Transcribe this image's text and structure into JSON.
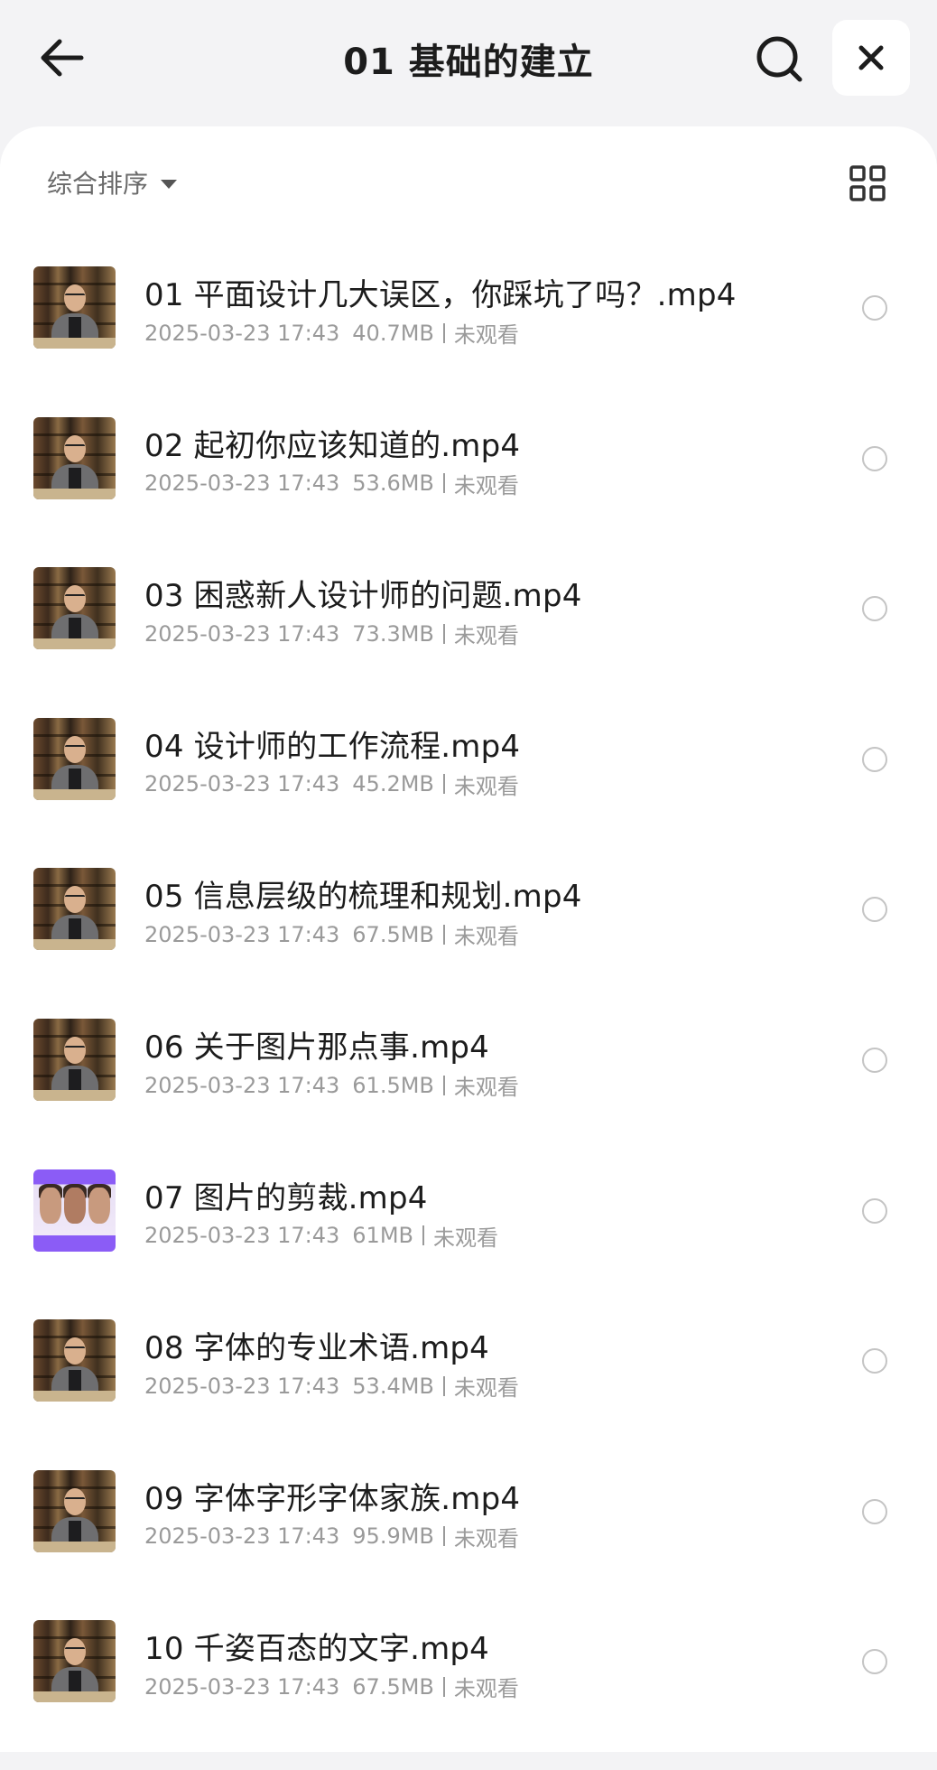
{
  "header": {
    "title": "01 基础的建立",
    "back_icon": "arrow-left-icon",
    "search_icon": "search-icon",
    "close_icon": "close-icon"
  },
  "toolbar": {
    "sort_label": "综合排序",
    "sort_icon": "caret-down-icon",
    "view_icon": "grid-view-icon"
  },
  "files": [
    {
      "name": "01 平面设计几大误区，你踩坑了吗？.mp4",
      "date": "2025-03-23 17:43",
      "size": "40.7MB",
      "status": "未观看",
      "thumb": "presenter"
    },
    {
      "name": "02 起初你应该知道的.mp4",
      "date": "2025-03-23 17:43",
      "size": "53.6MB",
      "status": "未观看",
      "thumb": "presenter"
    },
    {
      "name": "03 困惑新人设计师的问题.mp4",
      "date": "2025-03-23 17:43",
      "size": "73.3MB",
      "status": "未观看",
      "thumb": "presenter"
    },
    {
      "name": "04 设计师的工作流程.mp4",
      "date": "2025-03-23 17:43",
      "size": "45.2MB",
      "status": "未观看",
      "thumb": "presenter"
    },
    {
      "name": "05 信息层级的梳理和规划.mp4",
      "date": "2025-03-23 17:43",
      "size": "67.5MB",
      "status": "未观看",
      "thumb": "presenter"
    },
    {
      "name": "06 关于图片那点事.mp4",
      "date": "2025-03-23 17:43",
      "size": "61.5MB",
      "status": "未观看",
      "thumb": "presenter"
    },
    {
      "name": "07 图片的剪裁.mp4",
      "date": "2025-03-23 17:43",
      "size": "61MB",
      "status": "未观看",
      "thumb": "purple"
    },
    {
      "name": "08 字体的专业术语.mp4",
      "date": "2025-03-23 17:43",
      "size": "53.4MB",
      "status": "未观看",
      "thumb": "presenter"
    },
    {
      "name": "09 字体字形字体家族.mp4",
      "date": "2025-03-23 17:43",
      "size": "95.9MB",
      "status": "未观看",
      "thumb": "presenter"
    },
    {
      "name": "10 千姿百态的文字.mp4",
      "date": "2025-03-23 17:43",
      "size": "67.5MB",
      "status": "未观看",
      "thumb": "presenter"
    }
  ]
}
